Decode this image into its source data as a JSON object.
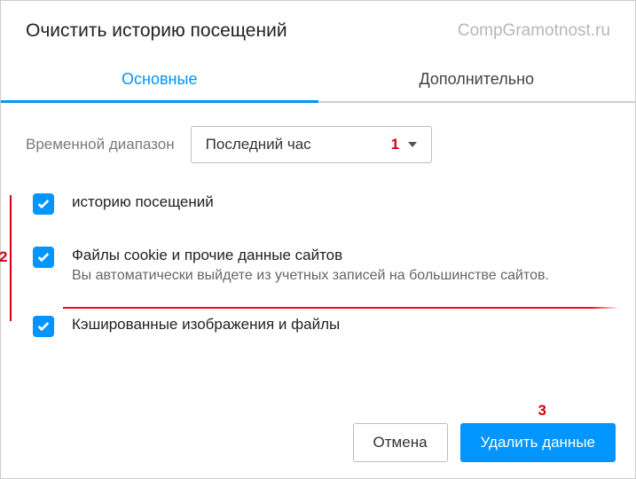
{
  "header": {
    "title": "Очистить историю посещений",
    "watermark": "CompGramotnost.ru"
  },
  "tabs": {
    "basic": "Основные",
    "advanced": "Дополнительно"
  },
  "time": {
    "label": "Временной диапазон",
    "selected": "Последний час"
  },
  "annotations": {
    "one": "1",
    "two": "2",
    "three": "3"
  },
  "options": {
    "history": {
      "label": "историю посещений"
    },
    "cookies": {
      "label": "Файлы cookie и прочие данные сайтов",
      "sub": "Вы автоматически выйдете из учетных записей на большинстве сайтов."
    },
    "cache": {
      "label": "Кэшированные изображения и файлы"
    }
  },
  "buttons": {
    "cancel": "Отмена",
    "clear": "Удалить данные"
  }
}
